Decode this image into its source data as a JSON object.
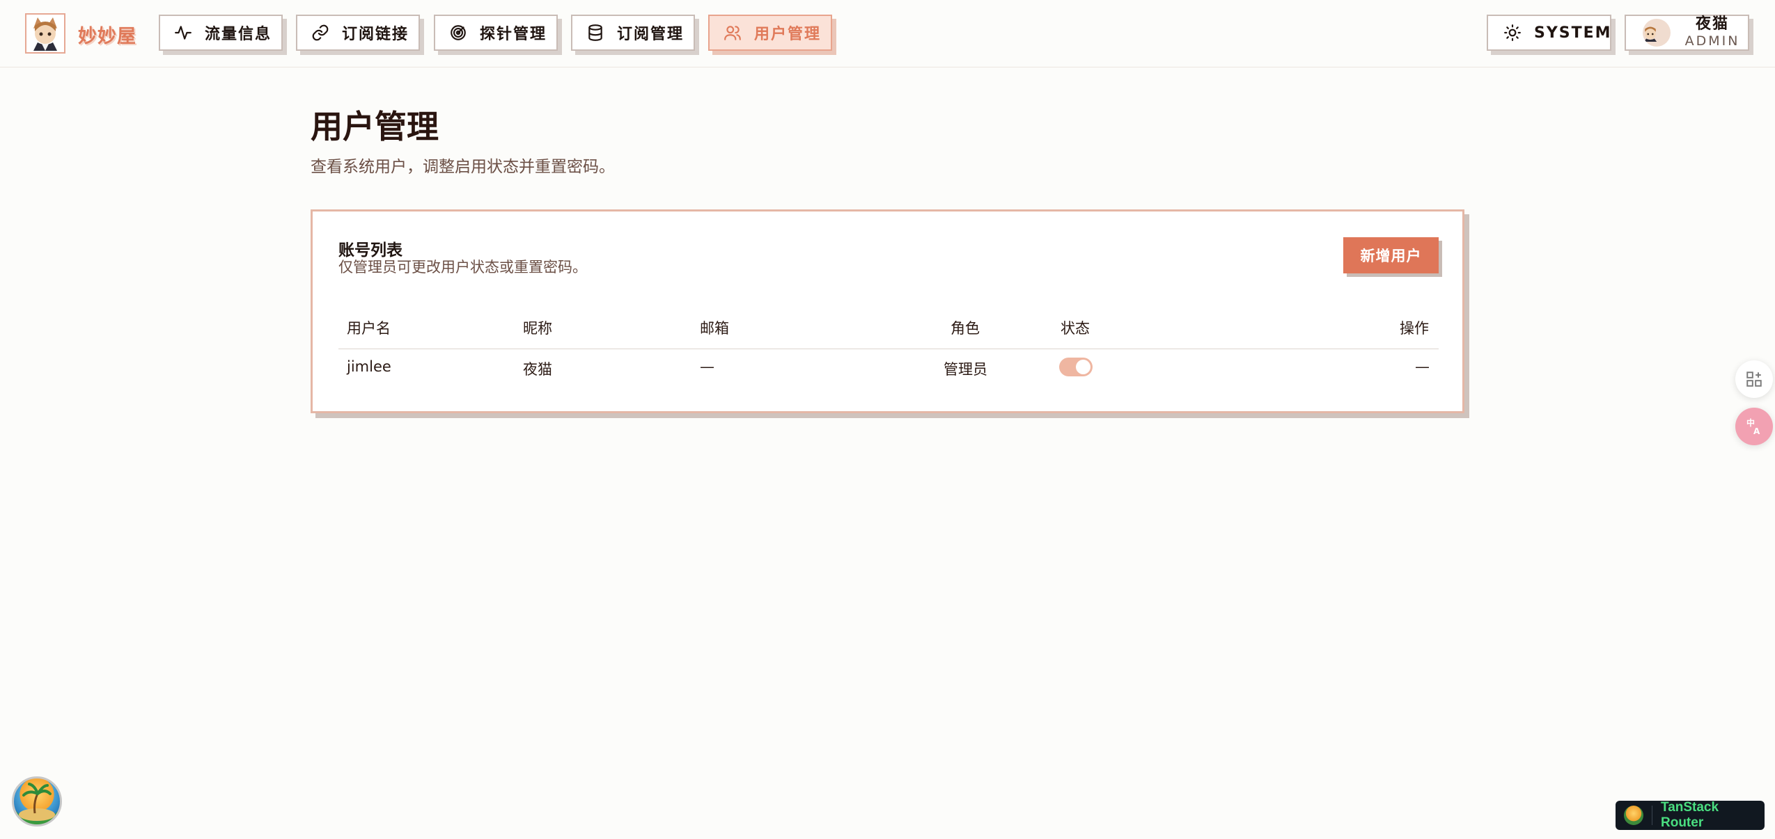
{
  "app": {
    "brand": "妙妙屋"
  },
  "nav": {
    "items": [
      {
        "label": "流量信息",
        "icon": "activity-icon"
      },
      {
        "label": "订阅链接",
        "icon": "link-icon"
      },
      {
        "label": "探针管理",
        "icon": "radar-icon"
      },
      {
        "label": "订阅管理",
        "icon": "database-icon"
      },
      {
        "label": "用户管理",
        "icon": "users-icon",
        "active": true
      }
    ],
    "theme_label": "SYSTEM",
    "user": {
      "name": "夜猫",
      "role": "ADMIN"
    }
  },
  "page": {
    "title": "用户管理",
    "subtitle": "查看系统用户，调整启用状态并重置密码。"
  },
  "card": {
    "title": "账号列表",
    "subtitle": "仅管理员可更改用户状态或重置密码。",
    "add_button": "新增用户",
    "columns": [
      "用户名",
      "昵称",
      "邮箱",
      "角色",
      "状态",
      "操作"
    ],
    "rows": [
      {
        "username": "jimlee",
        "nickname": "夜猫",
        "email": "—",
        "role": "管理员",
        "enabled": true,
        "actions": "—"
      }
    ]
  },
  "devtools": {
    "badge": "TanStack Router"
  },
  "colors": {
    "accent": "#df7658",
    "active_bg": "#fbe2d8",
    "toggle_on": "#efb6a1",
    "badge_text": "#4ade80"
  }
}
